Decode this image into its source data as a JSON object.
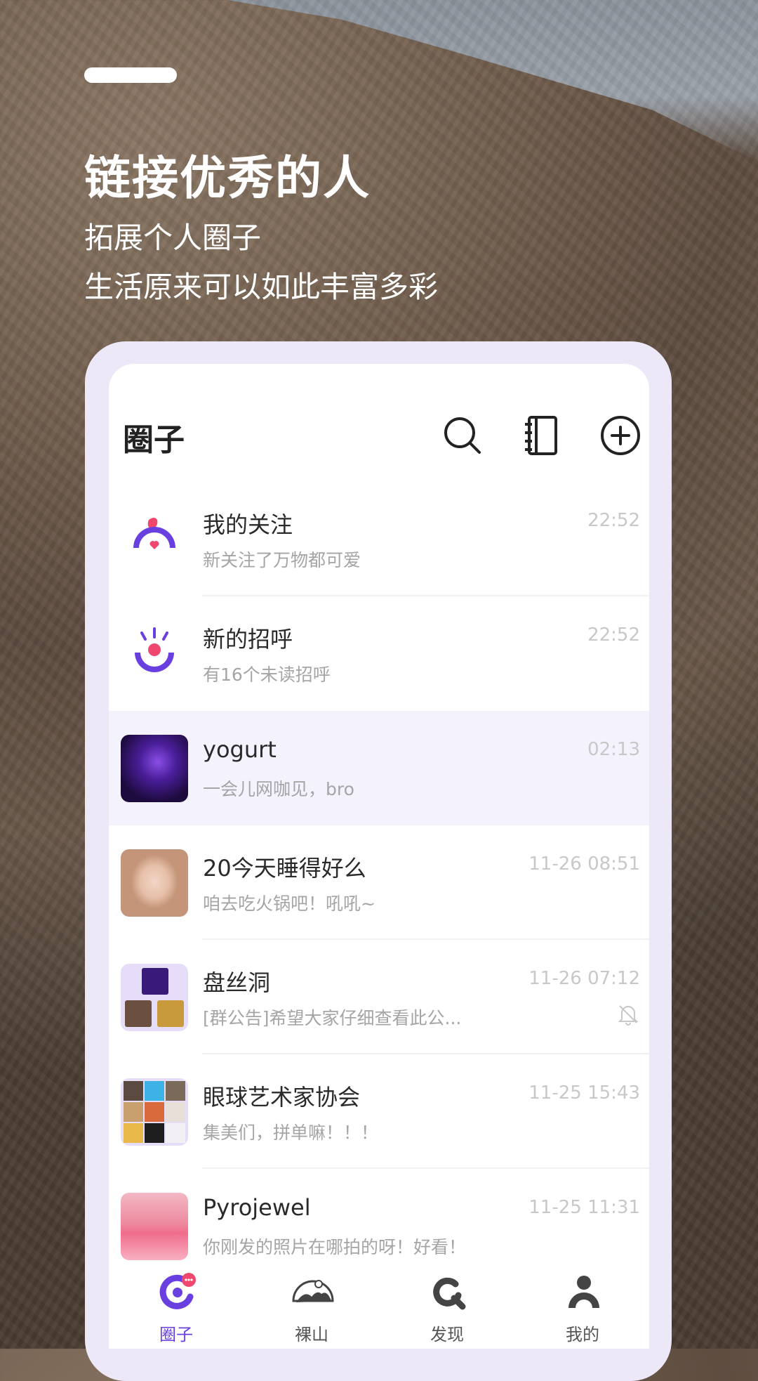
{
  "hero": {
    "title": "链接优秀的人",
    "subtitle1": "拓展个人圈子",
    "subtitle2": "生活原来可以如此丰富多彩"
  },
  "header": {
    "title": "圈子",
    "icons": [
      "search-icon",
      "contacts-book-icon",
      "add-circle-icon"
    ]
  },
  "conversations": [
    {
      "name": "我的关注",
      "preview": "新关注了万物都可爱",
      "time": "22:52",
      "avatar": "follow-icon"
    },
    {
      "name": "新的招呼",
      "preview": "有16个未读招呼",
      "time": "22:52",
      "avatar": "greeting-icon"
    },
    {
      "name": "yogurt",
      "preview": "一会儿网咖见，bro",
      "time": "02:13",
      "avatar": "purple-photo",
      "highlighted": true
    },
    {
      "name": "20今天睡得好么",
      "preview": "咱去吃火锅吧！吼吼~",
      "time": "11-26 08:51",
      "avatar": "girl-portrait"
    },
    {
      "name": "盘丝洞",
      "preview": "[群公告]希望大家仔细查看此公...",
      "time": "11-26 07:12",
      "avatar": "group-collage-3",
      "muted": true
    },
    {
      "name": "眼球艺术家协会",
      "preview": "集美们，拼单嘛！！！",
      "time": "11-25 15:43",
      "avatar": "group-collage-9"
    },
    {
      "name": "Pyrojewel",
      "preview": "你刚发的照片在哪拍的呀！好看！",
      "time": "11-25 11:31",
      "avatar": "pink-lips-photo"
    }
  ],
  "tabs": [
    {
      "label": "圈子",
      "icon": "circle-chat-icon",
      "active": true
    },
    {
      "label": "裸山",
      "icon": "mountain-icon"
    },
    {
      "label": "发现",
      "icon": "discover-icon"
    },
    {
      "label": "我的",
      "icon": "profile-icon"
    }
  ],
  "colors": {
    "accent": "#6a3fe0",
    "pink": "#f0476e",
    "phone_frame": "#ede8f8",
    "highlight_row": "#f4f2fd"
  }
}
